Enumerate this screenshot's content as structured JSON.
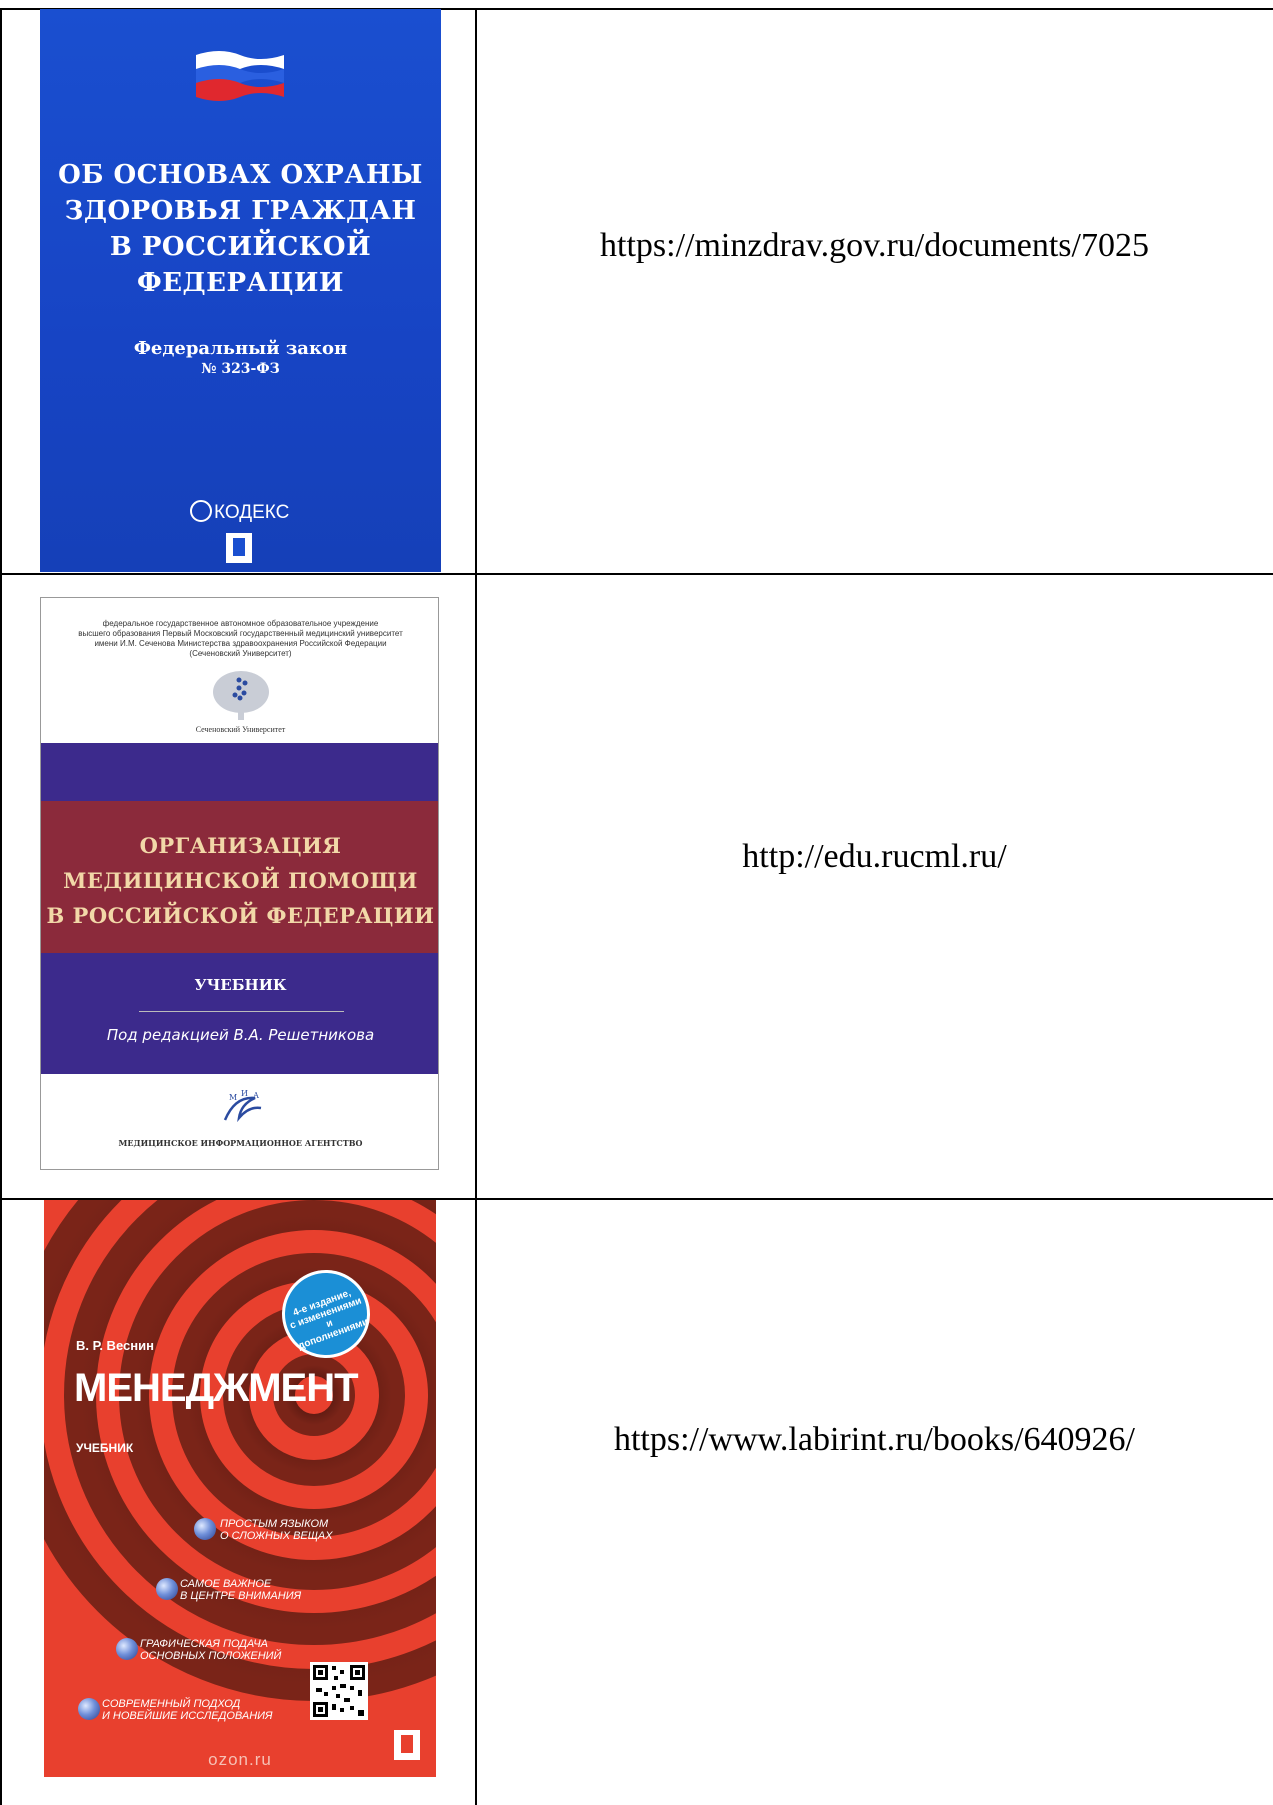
{
  "rows": [
    {
      "cover": {
        "title_lines": [
          "ОБ ОСНОВАХ ОХРАНЫ",
          "ЗДОРОВЬЯ ГРАЖДАН",
          "В РОССИЙСКОЙ",
          "ФЕДЕРАЦИИ"
        ],
        "subtitle": "Федеральный закон",
        "number": "№ 323-ФЗ",
        "publisher": "КОДЕКС",
        "colors": {
          "background": "#1a4fd0",
          "text": "#ffffff"
        }
      },
      "url": "https://minzdrav.gov.ru/documents/7025"
    },
    {
      "cover": {
        "institution_lines": [
          "федеральное государственное автономное образовательное учреждение",
          "высшего образования Первый Московский государственный медицинский университет",
          "имени И.М. Сеченова Министерства здравоохранения Российской Федерации",
          "(Сеченовский Университет)"
        ],
        "university": "Сеченовский Университет",
        "title_lines": [
          "ОРГАНИЗАЦИЯ",
          "МЕДИЦИНСКОЙ ПОМОЩИ",
          "В РОССИЙСКОЙ ФЕДЕРАЦИИ"
        ],
        "type": "УЧЕБНИК",
        "editor": "Под редакцией В.А. Решетникова",
        "agency": "МЕДИЦИНСКОЕ ИНФОРМАЦИОННОЕ АГЕНТСТВО",
        "colors": {
          "purple": "#3c2a8c",
          "burgundy": "#8b2a3b",
          "title": "#f2d8a8"
        }
      },
      "url": "http://edu.rucml.ru/"
    },
    {
      "cover": {
        "author": "В. Р. Веснин",
        "title": "МЕНЕДЖМЕНТ",
        "type": "УЧЕБНИК",
        "badge_lines": [
          "4-е издание,",
          "с изменениями",
          "и дополнениями"
        ],
        "features": [
          [
            "ПРОСТЫМ ЯЗЫКОМ",
            "О СЛОЖНЫХ ВЕЩАХ"
          ],
          [
            "САМОЕ ВАЖНОЕ",
            "В ЦЕНТРЕ ВНИМАНИЯ"
          ],
          [
            "ГРАФИЧЕСКАЯ ПОДАЧА",
            "ОСНОВНЫХ ПОЛОЖЕНИЙ"
          ],
          [
            "СОВРЕМЕННЫЙ ПОДХОД",
            "И НОВЕЙШИЕ ИССЛЕДОВАНИЯ"
          ]
        ],
        "watermark": "ozon.ru",
        "colors": {
          "background": "#e8402e",
          "rings": "#5a1a14",
          "badge": "#1b8fd6"
        }
      },
      "url": "https://www.labirint.ru/books/640926/"
    }
  ]
}
